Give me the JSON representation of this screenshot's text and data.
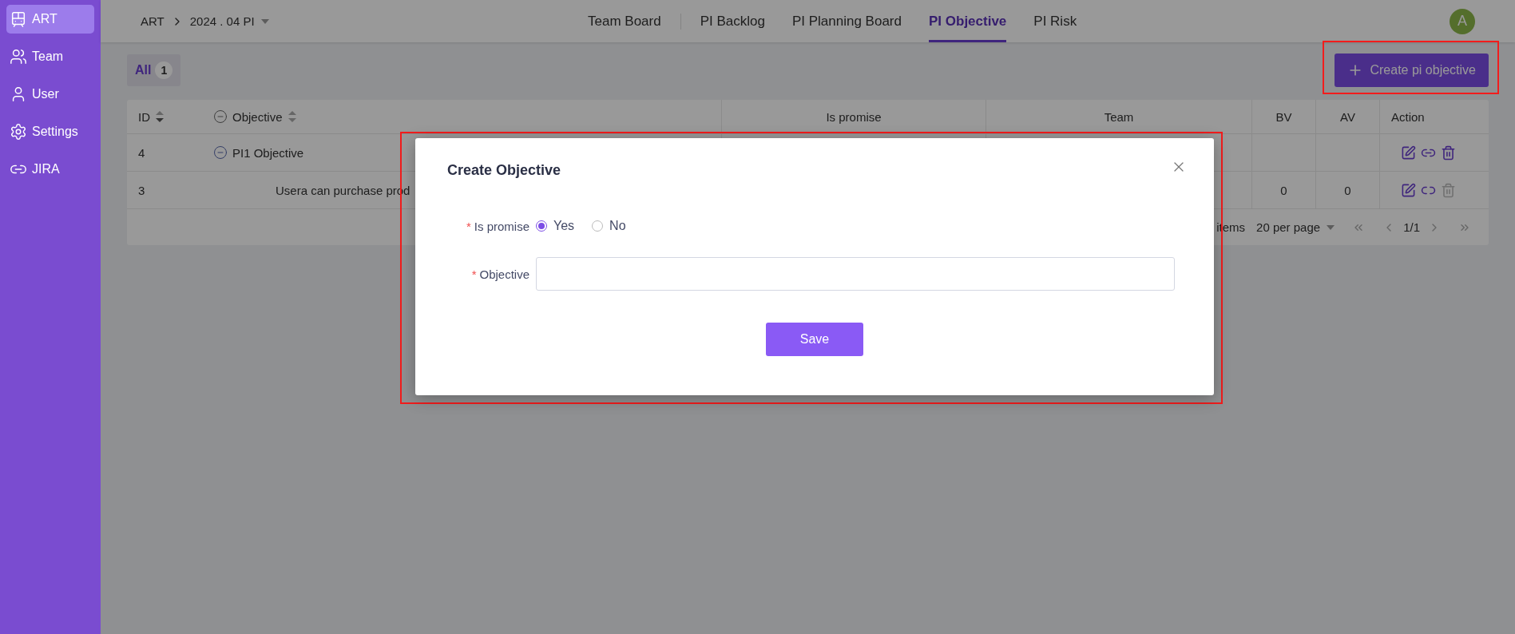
{
  "sidebar": {
    "items": [
      {
        "label": "ART",
        "selected": true
      },
      {
        "label": "Team",
        "selected": false
      },
      {
        "label": "User",
        "selected": false
      },
      {
        "label": "Settings",
        "selected": false
      },
      {
        "label": "JIRA",
        "selected": false
      }
    ]
  },
  "breadcrumb": {
    "root": "ART",
    "current": "2024 . 04 PI"
  },
  "nav_tabs": [
    {
      "label": "Team Board",
      "selected": false
    },
    {
      "label": "PI Backlog",
      "selected": false
    },
    {
      "label": "PI Planning Board",
      "selected": false
    },
    {
      "label": "PI Objective",
      "selected": true
    },
    {
      "label": "PI Risk",
      "selected": false
    }
  ],
  "avatar": "A",
  "filter": {
    "label": "All",
    "count": "1"
  },
  "create_button": "Create pi objective",
  "table": {
    "columns": [
      "ID",
      "Objective",
      "Is promise",
      "Team",
      "BV",
      "AV",
      "Action"
    ],
    "rows": [
      {
        "id": "4",
        "objective": "PI1 Objective",
        "expanded": true,
        "actions": [
          {
            "kind": "edit",
            "disabled": false
          },
          {
            "kind": "link",
            "disabled": false
          },
          {
            "kind": "delete",
            "disabled": false
          }
        ],
        "children": [
          {
            "id": "3",
            "objective": "Usera can purchase prod",
            "bv": "0",
            "av": "0",
            "actions": [
              {
                "kind": "edit",
                "disabled": false
              },
              {
                "kind": "unlink",
                "disabled": false
              },
              {
                "kind": "delete",
                "disabled": true
              }
            ]
          }
        ]
      }
    ]
  },
  "pagination": {
    "total": "items",
    "page_size": "20 per page",
    "page": "1/1"
  },
  "dialog": {
    "title": "Create Objective",
    "fields": [
      {
        "kind": "radio",
        "label": "Is promise",
        "required_mark": "*",
        "options": [
          {
            "label": "Yes",
            "selected": true
          },
          {
            "label": "No",
            "selected": false
          }
        ]
      },
      {
        "kind": "text",
        "label": "Objective",
        "required_mark": "*"
      }
    ],
    "save": "Save"
  }
}
